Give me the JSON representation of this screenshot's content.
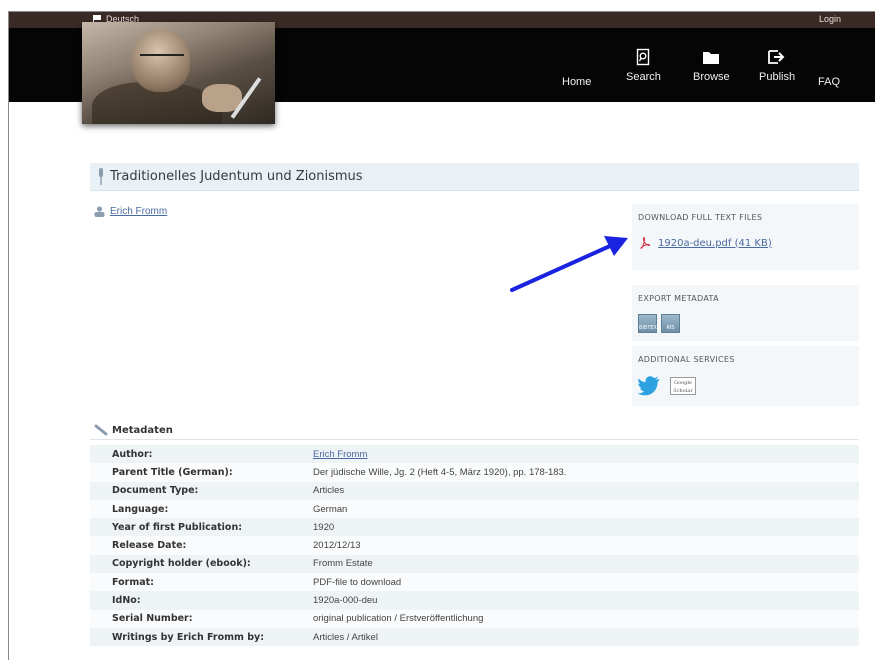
{
  "topbar": {
    "language": "Deutsch",
    "login": "Login"
  },
  "nav": [
    {
      "label": "Home",
      "icon": "none"
    },
    {
      "label": "Search",
      "icon": "search-icon"
    },
    {
      "label": "Browse",
      "icon": "folder-icon"
    },
    {
      "label": "Publish",
      "icon": "publish-icon"
    },
    {
      "label": "FAQ",
      "icon": "none"
    }
  ],
  "document": {
    "title": "Traditionelles Judentum und Zionismus",
    "author": "Erich Fromm"
  },
  "sidebar": {
    "download_heading": "DOWNLOAD FULL TEXT FILES",
    "download_link": "1920a-deu.pdf (41 KB)",
    "export_heading": "EXPORT METADATA",
    "export_buttons": [
      "BIBTEX",
      "RIS"
    ],
    "services_heading": "ADDITIONAL SERVICES",
    "scholar_label": "Google Scholar"
  },
  "metadata": {
    "heading": "Metadaten",
    "rows": [
      {
        "key": "Author:",
        "value": "Erich Fromm",
        "link": true
      },
      {
        "key": "Parent Title (German):",
        "value": "Der jüdische Wille, Jg. 2 (Heft 4-5, März 1920), pp. 178-183."
      },
      {
        "key": "Document Type:",
        "value": "Articles"
      },
      {
        "key": "Language:",
        "value": "German"
      },
      {
        "key": "Year of first Publication:",
        "value": "1920"
      },
      {
        "key": "Release Date:",
        "value": "2012/12/13"
      },
      {
        "key": "Copyright holder (ebook):",
        "value": "Fromm Estate"
      },
      {
        "key": "Format:",
        "value": "PDF-file to download"
      },
      {
        "key": "IdNo:",
        "value": "1920a-000-deu"
      },
      {
        "key": "Serial Number:",
        "value": "original publication / Erstveröffentlichung"
      },
      {
        "key": "Writings by Erich Fromm by:",
        "value": "Articles / Artikel"
      }
    ]
  },
  "colors": {
    "accent_arrow": "#1a24e0",
    "link": "#4a6aa0",
    "header_bg": "#050505",
    "topbar_bg": "#3a2a25"
  }
}
